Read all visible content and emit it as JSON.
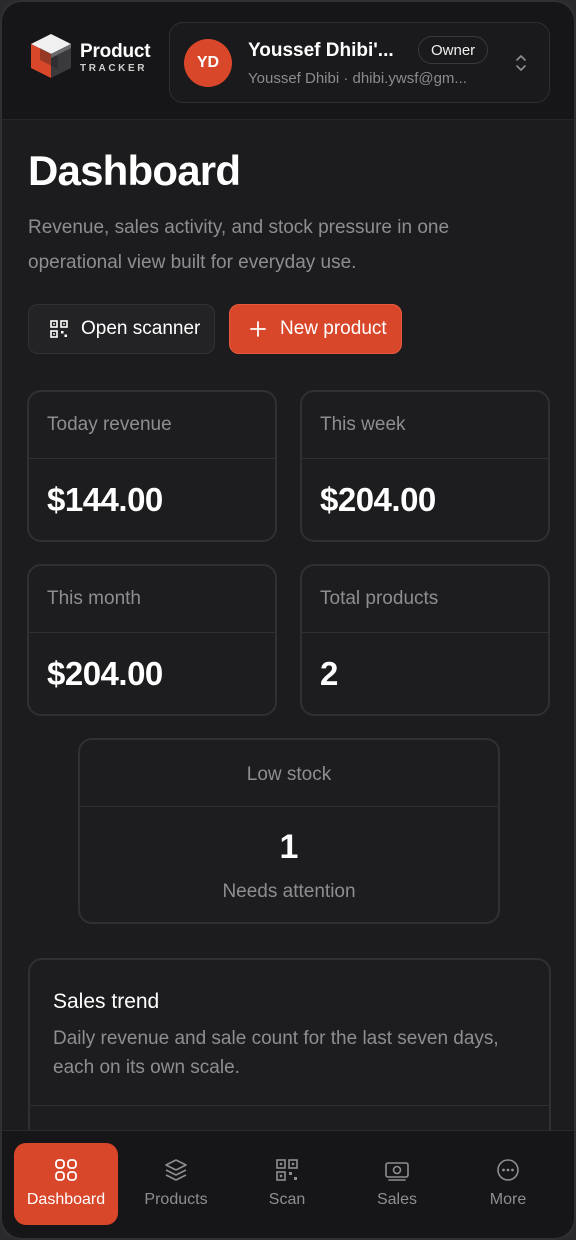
{
  "brand": {
    "title": "Product",
    "subtitle": "TRACKER"
  },
  "account": {
    "initials": "YD",
    "name": "Youssef Dhibi'...",
    "role": "Owner",
    "sub": "Youssef Dhibi · dhibi.ywsf@gm..."
  },
  "page": {
    "title": "Dashboard",
    "description": "Revenue, sales activity, and stock pressure in one operational view built for everyday use."
  },
  "actions": {
    "scanner": "Open scanner",
    "new_product": "New product"
  },
  "stats": [
    {
      "label": "Today revenue",
      "value": "$144.00"
    },
    {
      "label": "This week",
      "value": "$204.00"
    },
    {
      "label": "This month",
      "value": "$204.00"
    },
    {
      "label": "Total products",
      "value": "2"
    }
  ],
  "low_stock": {
    "label": "Low stock",
    "value": "1",
    "note": "Needs attention"
  },
  "sales_trend": {
    "title": "Sales trend",
    "description": "Daily revenue and sale count for the last seven days, each on its own scale."
  },
  "nav": [
    {
      "label": "Dashboard",
      "icon": "grid-icon",
      "active": true
    },
    {
      "label": "Products",
      "icon": "layers-icon",
      "active": false
    },
    {
      "label": "Scan",
      "icon": "qr-icon",
      "active": false
    },
    {
      "label": "Sales",
      "icon": "banknote-icon",
      "active": false
    },
    {
      "label": "More",
      "icon": "more-icon",
      "active": false
    }
  ],
  "colors": {
    "accent": "#d9472b",
    "background": "#1c1c1e",
    "muted": "#8e8e92"
  }
}
